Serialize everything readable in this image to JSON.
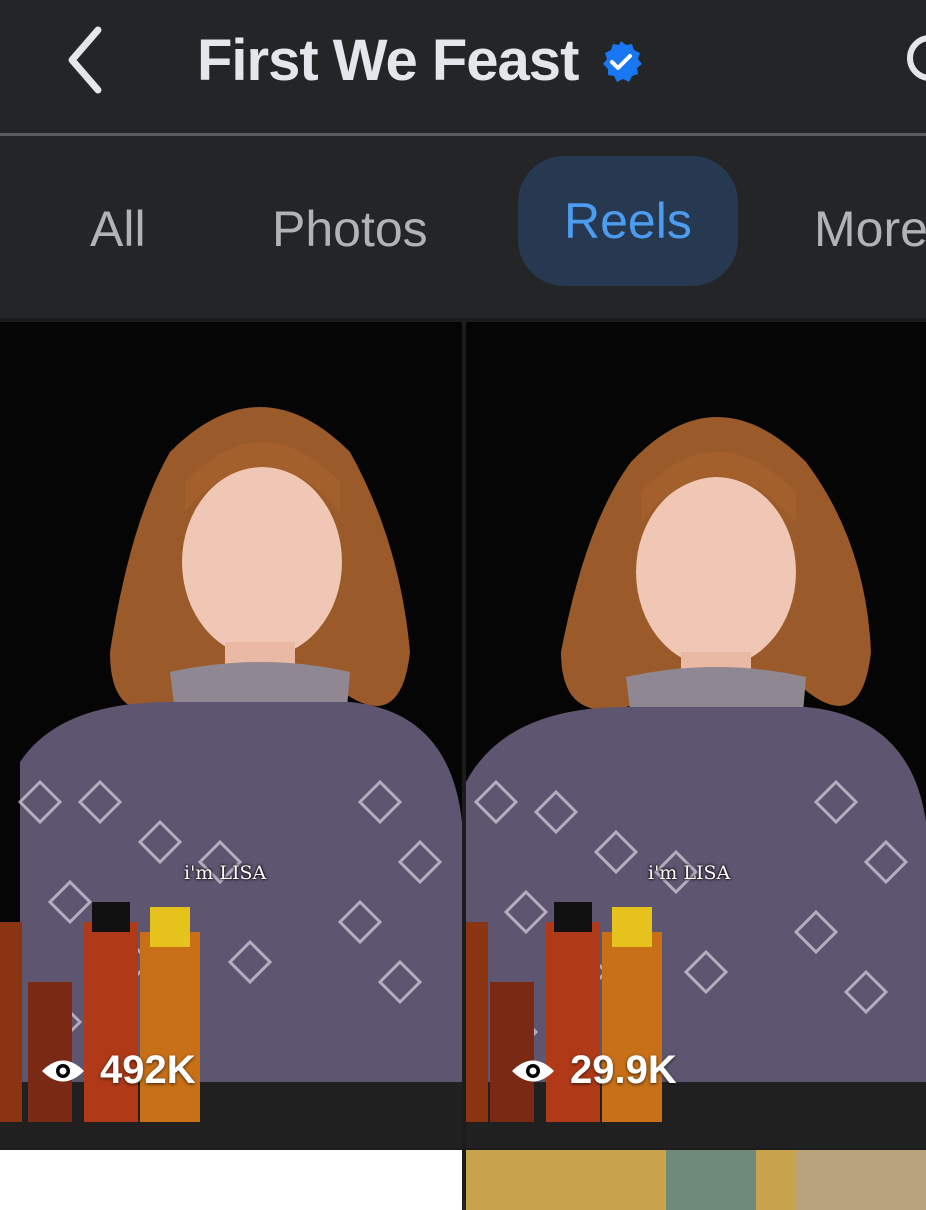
{
  "header": {
    "title": "First We Feast",
    "verified_color": "#1877f2"
  },
  "tabs": [
    {
      "label": "All",
      "active": false
    },
    {
      "label": "Photos",
      "active": false
    },
    {
      "label": "Reels",
      "active": true
    },
    {
      "label": "More",
      "active": false
    }
  ],
  "reels": [
    {
      "views": "492K",
      "caption": "i'm LISA"
    },
    {
      "views": "29.9K",
      "caption": "i'm LISA"
    }
  ],
  "icons": [
    "chevron-left-icon",
    "verified-badge-icon",
    "search-icon",
    "eye-icon"
  ],
  "colors": {
    "background": "#242526",
    "active_tab_bg": "#263951",
    "active_tab_text": "#4c9cf0",
    "tab_text": "#b0b3b8"
  }
}
